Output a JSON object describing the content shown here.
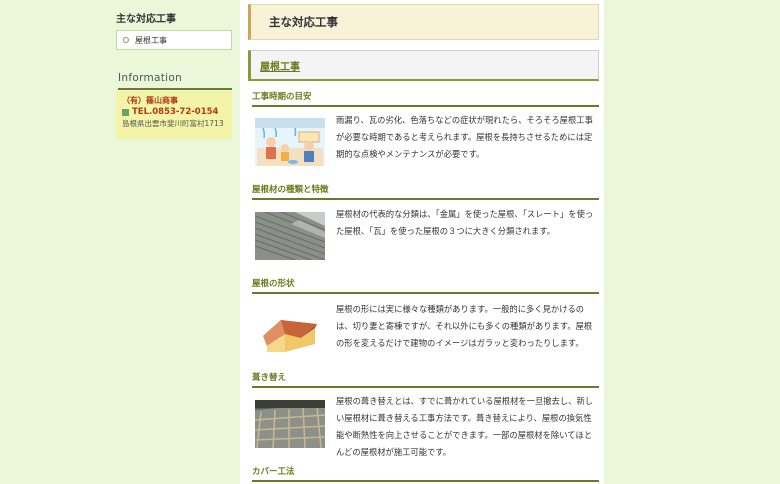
{
  "sidebar": {
    "heading": "主な対応工事",
    "items": [
      {
        "label": "屋根工事"
      }
    ],
    "info_heading": "Information",
    "company": "（有）篠山商事",
    "tel": "TEL.0853-72-0154",
    "address": "島根県出雲市斐川町富村1713"
  },
  "main": {
    "page_title": "主な対応工事",
    "section_title": "屋根工事",
    "topics": [
      {
        "heading": "工事時期の目安",
        "text": "雨漏り、瓦の劣化、色落ちなどの症状が現れたら、そろそろ屋根工事が必要な時期であると考えられます。屋根を長持ちさせるためには定期的な点検やメンテナンスが必要です。",
        "image_icon": "family-illustration"
      },
      {
        "heading": "屋根材の種類と特徴",
        "text": "屋根材の代表的な分類は、「金属」を使った屋根、「スレート」を使った屋根、「瓦」を使った屋根の３つに大きく分類されます。",
        "image_icon": "metal-roof-photo"
      },
      {
        "heading": "屋根の形状",
        "text": "屋根の形には実に様々な種類があります。一般的に多く見かけるのは、切り妻と寄棟ですが、それ以外にも多くの種類があります。屋根の形を変えるだけで建物のイメージはガラッと変わったりします。",
        "image_icon": "house-illustration"
      },
      {
        "heading": "葺き替え",
        "text": "屋根の葺き替えとは、すでに葺かれている屋根材を一旦撤去し、新しい屋根材に葺き替える工事方法です。葺き替えにより、屋根の換気性能や断熱性を向上させることができます。一部の屋根材を除いてほとんどの屋根材が施工可能です。",
        "image_icon": "reroofing-photo"
      },
      {
        "heading": "カバー工法"
      }
    ]
  },
  "colors": {
    "background": "#eaf7d8",
    "accent": "#6b7a2a",
    "company_red": "#b03a1a"
  }
}
